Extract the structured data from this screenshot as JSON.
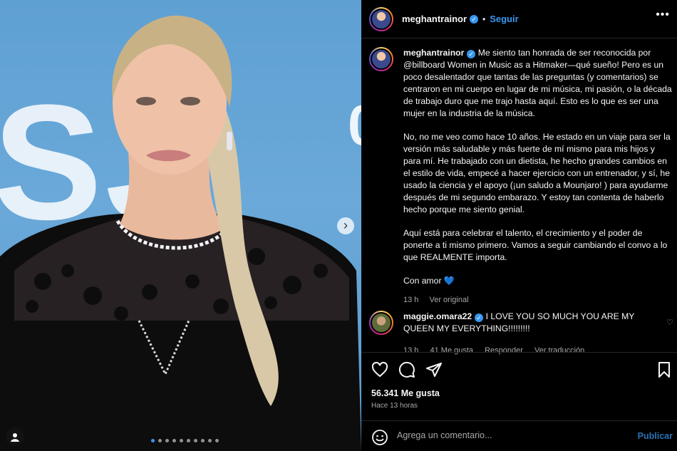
{
  "photo": {
    "bg_letters": "SJ",
    "bg_fragment": "0",
    "nav_next": "›",
    "carousel_total": 10,
    "carousel_active": 1
  },
  "header": {
    "username": "meghantrainor",
    "separator": "•",
    "follow_label": "Seguir",
    "more_label": "•••"
  },
  "caption": {
    "username": "meghantrainor",
    "p1": "Me siento tan honrada de ser reconocida por @billboard Women in Music as a Hitmaker—qué sueño! Pero es un poco desalentador que tantas de las preguntas (y comentarios) se centraron en mi cuerpo en lugar de mi música, mi pasión, o la década de trabajo duro que me trajo hasta aquí. Esto es lo que es ser una mujer en la industria de la música.",
    "p2": "No, no me veo como hace 10 años. He estado en un viaje para ser la versión más saludable y más fuerte de mí mismo para mis hijos y para mí. He trabajado con un dietista, he hecho grandes cambios en el estilo de vida, empecé a hacer ejercicio con un entrenador, y sí, he usado la ciencia y el apoyo (¡un saludo a Mounjaro! ) para ayudarme después de mi segundo embarazo. Y estoy tan contenta de haberlo hecho porque me siento genial.",
    "p3": "Aquí está para celebrar el talento, el crecimiento y el poder de ponerte a ti mismo primero. Vamos a seguir cambiando el convo a lo que REALMENTE importa.",
    "p4": "Con amor",
    "p4_emoji": "💙",
    "time": "13 h",
    "see_original": "Ver original"
  },
  "comment": {
    "username": "maggie.omara22",
    "text": "I LOVE YOU SO MUCH YOU ARE MY QUEEN MY EVERYTHING!!!!!!!!!",
    "time": "13 h",
    "likes": "41 Me gusta",
    "reply": "Responder",
    "see_translation": "Ver traducción",
    "heart": "♡"
  },
  "actions": {
    "likes": "56.341 Me gusta",
    "time_ago": "Hace 13 horas"
  },
  "comment_box": {
    "placeholder": "Agrega un comentario...",
    "publish": "Publicar"
  },
  "colors": {
    "accent": "#3897f0",
    "background": "#000000",
    "muted": "#a8a8a8",
    "photo_sky": "#6aa9d9"
  }
}
